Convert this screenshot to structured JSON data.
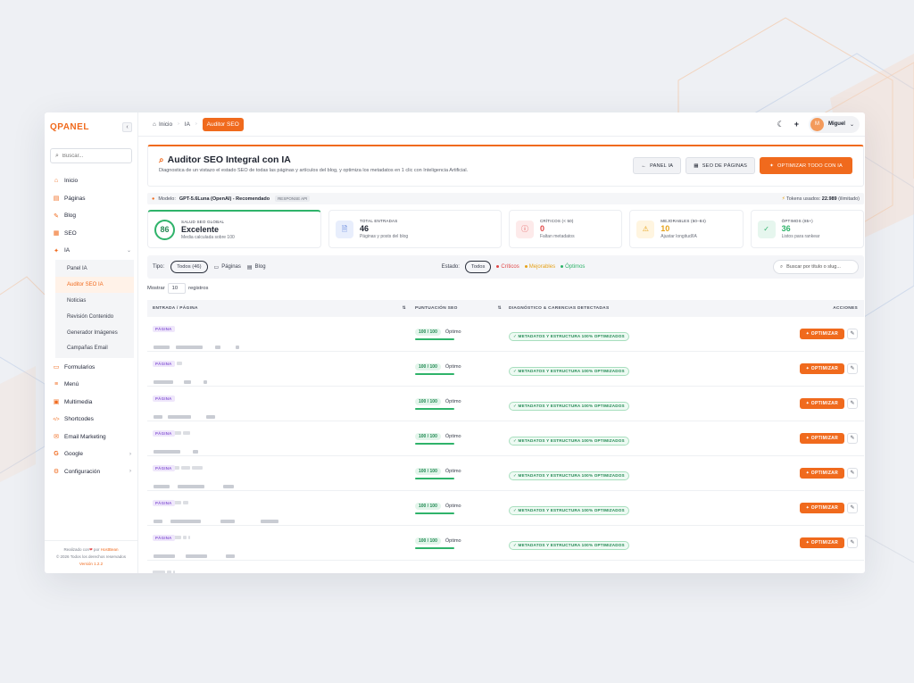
{
  "app": {
    "logo": "QPANEL",
    "collapse_icon": "‹"
  },
  "sidebar": {
    "search_placeholder": "Buscar...",
    "items": [
      {
        "label": "Inicio",
        "icon": "⌂"
      },
      {
        "label": "Páginas",
        "icon": "▤"
      },
      {
        "label": "Blog",
        "icon": "✎"
      },
      {
        "label": "SEO",
        "icon": "▦"
      },
      {
        "label": "IA",
        "icon": "✦",
        "chev": "⌄"
      }
    ],
    "sub_items": [
      {
        "label": "Panel IA"
      },
      {
        "label": "Auditor SEO IA",
        "active": true
      },
      {
        "label": "Noticias"
      },
      {
        "label": "Revisión Contenido"
      },
      {
        "label": "Generador Imágenes"
      },
      {
        "label": "Campañas Email"
      }
    ],
    "items_after": [
      {
        "label": "Formularios",
        "icon": "▭"
      },
      {
        "label": "Menú",
        "icon": "≡"
      },
      {
        "label": "Multimedia",
        "icon": "▣"
      },
      {
        "label": "Shortcodes",
        "icon": "</>"
      },
      {
        "label": "Email Marketing",
        "icon": "✉"
      },
      {
        "label": "Google",
        "icon": "G",
        "chev": "›"
      },
      {
        "label": "Configuración",
        "icon": "⚙",
        "chev": "›"
      }
    ],
    "footer": {
      "made_prefix": "Realizado con",
      "heart": "❤",
      "by": "por",
      "brand": "HostBean",
      "rights": "© 2026 Todos los derechos reservados",
      "version": "Versión 1.2.2"
    }
  },
  "topbar": {
    "breadcrumb": [
      {
        "label": "Inicio"
      },
      {
        "label": "IA"
      }
    ],
    "active_crumb": "Auditor SEO",
    "user": {
      "initial": "M",
      "name": "Miguel"
    }
  },
  "hero": {
    "title": "Auditor SEO Integral con IA",
    "subtitle": "Diagnostica de un vistazo el estado SEO de todas las páginas y artículos del blog, y optimiza los metadatos en 1 clic con Inteligencia Artificial.",
    "buttons": {
      "panel": "PANEL IA",
      "seo": "SEO DE PÁGINAS",
      "optimize_all": "OPTIMIZAR TODO CON IA"
    }
  },
  "model": {
    "label": "Modelo:",
    "name": "GPT-5.6Luna (OpenAI) - Recomendado",
    "tag": "RESPONSE API",
    "tokens_label": "Tokens usados:",
    "tokens_value": "22.989",
    "tokens_suffix": "(ilimitado)"
  },
  "stats": {
    "global": {
      "score": "86",
      "label": "SALUD SEO GLOBAL",
      "value": "Excelente",
      "sub": "Media calculada sobre 100"
    },
    "total": {
      "label": "TOTAL ENTRADAS",
      "value": "46",
      "sub": "Páginas y posts del blog"
    },
    "critical": {
      "label": "CRÍTICOS (< 50)",
      "value": "0",
      "sub": "Faltan metadatos"
    },
    "improvable": {
      "label": "MEJORABLES (50–84)",
      "value": "10",
      "sub": "Ajustar longitud/IA"
    },
    "optimal": {
      "label": "ÓPTIMOS (85+)",
      "value": "36",
      "sub": "Listos para rankear"
    }
  },
  "filters": {
    "type_label": "Tipo:",
    "type_all": "Todos (46)",
    "type_pages": "Páginas",
    "type_blog": "Blog",
    "status_label": "Estado:",
    "status_all": "Todos",
    "status_critical": "Críticos",
    "status_improvable": "Mejorables",
    "status_optimal": "Óptimos",
    "search_placeholder": "Buscar por título o slug..."
  },
  "show": {
    "prefix": "Mostrar",
    "value": "10",
    "suffix": "registros"
  },
  "table": {
    "headers": {
      "entry": "ENTRADA / PÁGINA",
      "score": "PUNTUACIÓN SEO",
      "diag": "DIAGNÓSTICO & CARENCIAS DETECTADAS",
      "actions": "ACCIONES",
      "sort": "⇅"
    },
    "rows": [
      {
        "type": "PÁGINA",
        "score": "100 / 100",
        "status": "Óptimo",
        "diag": "METADATOS Y ESTRUCTURA 100% OPTIMIZADOS",
        "action": "OPTIMIZAR"
      },
      {
        "type": "PÁGINA",
        "score": "100 / 100",
        "status": "Óptimo",
        "diag": "METADATOS Y ESTRUCTURA 100% OPTIMIZADOS",
        "action": "OPTIMIZAR"
      },
      {
        "type": "PÁGINA",
        "score": "100 / 100",
        "status": "Óptimo",
        "diag": "METADATOS Y ESTRUCTURA 100% OPTIMIZADOS",
        "action": "OPTIMIZAR"
      },
      {
        "type": "PÁGINA",
        "score": "100 / 100",
        "status": "Óptimo",
        "diag": "METADATOS Y ESTRUCTURA 100% OPTIMIZADOS",
        "action": "OPTIMIZAR"
      },
      {
        "type": "PÁGINA",
        "score": "100 / 100",
        "status": "Óptimo",
        "diag": "METADATOS Y ESTRUCTURA 100% OPTIMIZADOS",
        "action": "OPTIMIZAR"
      },
      {
        "type": "PÁGINA",
        "score": "100 / 100",
        "status": "Óptimo",
        "diag": "METADATOS Y ESTRUCTURA 100% OPTIMIZADOS",
        "action": "OPTIMIZAR"
      },
      {
        "type": "PÁGINA",
        "score": "100 / 100",
        "status": "Óptimo",
        "diag": "METADATOS Y ESTRUCTURA 100% OPTIMIZADOS",
        "action": "OPTIMIZAR"
      }
    ]
  },
  "colors": {
    "accent": "#f06a1d",
    "success": "#2fb36a",
    "danger": "#e04848",
    "warning": "#e6a21a"
  }
}
